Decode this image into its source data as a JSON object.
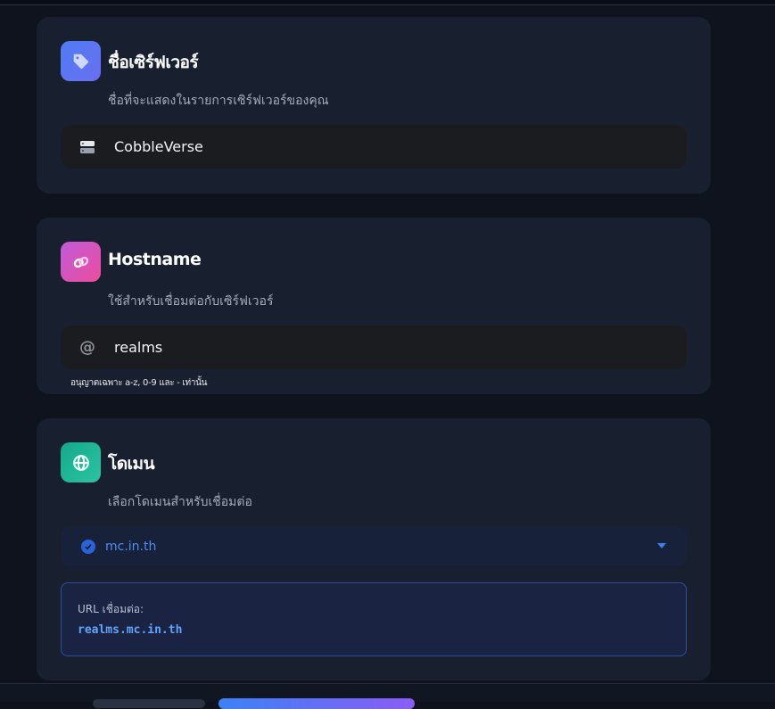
{
  "server_name": {
    "title": "ชื่อเซิร์ฟเวอร์",
    "subtitle": "ชื่อที่จะแสดงในรายการเซิร์ฟเวอร์ของคุณ",
    "value": "CobbleVerse",
    "icon": "tag-icon",
    "field_icon": "server-icon"
  },
  "hostname": {
    "title": "Hostname",
    "subtitle": "ใช้สำหรับเชื่อมต่อกับเซิร์ฟเวอร์",
    "value": "realms",
    "field_icon": "at-icon",
    "hint": "อนุญาตเฉพาะ a-z, 0-9 และ - เท่านั้น",
    "icon": "link-icon"
  },
  "domain": {
    "title": "โดเมน",
    "subtitle": "เลือกโดเมนสำหรับเชื่อมต่อ",
    "selected": "mc.in.th",
    "url_label": "URL เชื่อมต่อ:",
    "url_value": "realms.mc.in.th",
    "icon": "globe-icon"
  },
  "colors": {
    "accent": "#3b82f6",
    "background": "#0e131e",
    "card": "#182030"
  }
}
